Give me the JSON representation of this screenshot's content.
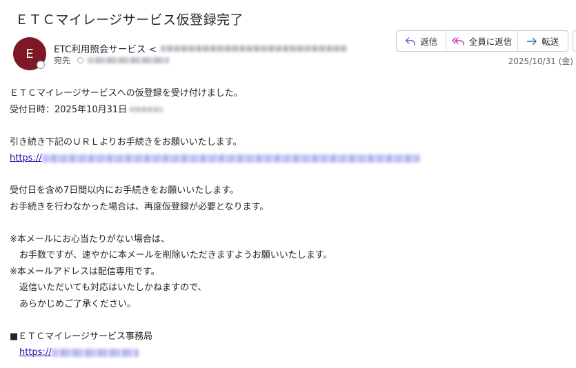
{
  "email": {
    "subject": "ＥＴＣマイレージサービス仮登録完了",
    "avatar_initial": "E",
    "sender_name": "ETC利用照会サービス <",
    "to_label": "宛先",
    "date": "2025/10/31 (金)"
  },
  "toolbar": {
    "reply_label": "返信",
    "reply_all_label": "全員に返信",
    "forward_label": "転送"
  },
  "body": {
    "line1": "ＥＴＣマイレージサービスへの仮登録を受け付けました。",
    "line2": "受付日時：2025年10月31日",
    "line3": "引き続き下記のＵＲＬよりお手続きをお願いいたします。",
    "link1_text": "https://",
    "line4": "受付日を含め7日間以内にお手続きをお願いいたします。",
    "line5": "お手続きを行わなかった場合は、再度仮登録が必要となります。",
    "line6": "※本メールにお心当たりがない場合は、",
    "line7": "お手数ですが、速やかに本メールを削除いただきますようお願いいたします。",
    "line8": "※本メールアドレスは配信専用です。",
    "line9": "返信いただいても対応はいたしかねますので、",
    "line10": "あらかじめご了承ください。",
    "signature": "■ＥＴＣマイレージサービス事務局",
    "link2_text": "https://"
  },
  "colors": {
    "avatar_bg": "#7e1824",
    "link": "#1a0dab",
    "reply_icon": "#5b5fc7",
    "reply_all_icon": "#c239b3",
    "forward_icon": "#0f6cbd"
  },
  "icons": [
    "reply-icon",
    "reply-all-icon",
    "forward-icon"
  ]
}
